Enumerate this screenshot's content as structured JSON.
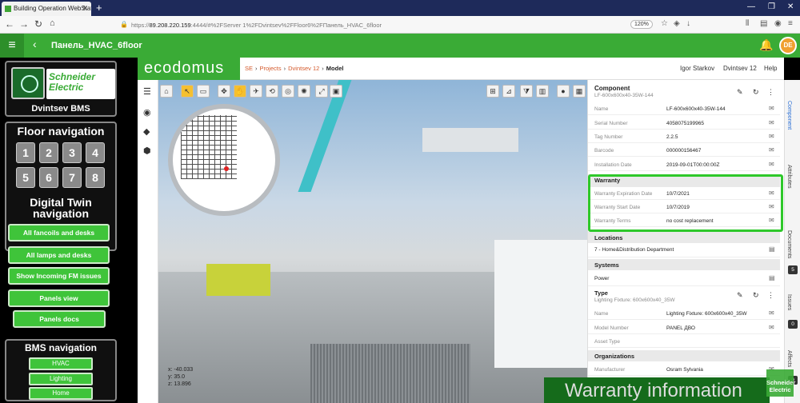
{
  "browser": {
    "tab_title": "Building Operation WebStation",
    "url_host": "89.208.220.159",
    "url_rest": ":4444/#%2FServer 1%2FDvintsev%2FFloor6%2FПанель_HVAC_6floor",
    "url_scheme": "https://",
    "zoom": "120%"
  },
  "app_header": {
    "title": "Панель_HVAC_6floor",
    "avatar": "DE"
  },
  "left_panel": {
    "brand": "Schneider Electric",
    "bms_title": "Dvintsev BMS",
    "floor_nav_title": "Floor navigation",
    "floors": [
      "1",
      "2",
      "3",
      "4",
      "5",
      "6",
      "7",
      "8"
    ],
    "digital_twin_title": "Digital Twin navigation",
    "digital_twin_buttons": [
      "All fancoils and desks",
      "All lamps and desks",
      "Show Incoming FM issues",
      "Panels view",
      "Panels docs"
    ],
    "bms_nav_title": "BMS navigation",
    "bms_buttons": [
      "HVAC",
      "Lighting",
      "Home"
    ]
  },
  "ecodomus": {
    "logo": "ecodomus",
    "breadcrumb": [
      "SE",
      "Projects",
      "Dvintsev 12",
      "Model"
    ],
    "user": "Igor Starkov",
    "project": "Dvintsev 12",
    "help": "Help"
  },
  "viewport": {
    "coords": [
      "x: -40.033",
      "y: 35.0",
      "z: 13.896"
    ]
  },
  "component": {
    "title": "Component",
    "subtitle": "LF-600x600x40-35W-144",
    "properties": [
      {
        "key": "Name",
        "value": "LF-600x600x40-35W-144"
      },
      {
        "key": "Serial Number",
        "value": "4058075199965"
      },
      {
        "key": "Tag Number",
        "value": "2.2.5"
      },
      {
        "key": "Barcode",
        "value": "000000156467"
      },
      {
        "key": "Installation Date",
        "value": "2019-09-01T00:00:00Z"
      }
    ],
    "warranty_title": "Warranty",
    "warranty": [
      {
        "key": "Warranty Expiration Date",
        "value": "10/7/2021"
      },
      {
        "key": "Warranty Start Date",
        "value": "10/7/2019"
      },
      {
        "key": "Warranty Terms",
        "value": "no cost replacement"
      }
    ],
    "locations_title": "Locations",
    "location": "7 - Home&Distribution Department",
    "systems_title": "Systems",
    "system": "Power",
    "type_title": "Type",
    "type_subtitle": "Lighting Fixture: 600x600x40_35W",
    "type_props": [
      {
        "key": "Name",
        "value": "Lighting Fixture: 600x600x40_35W"
      },
      {
        "key": "Model Number",
        "value": "PANEL ДВО"
      },
      {
        "key": "Asset Type",
        "value": ""
      }
    ],
    "organizations_title": "Organizations",
    "org_props": [
      {
        "key": "Manufacturer",
        "value": "Osram Sylvania"
      }
    ]
  },
  "right_tabs": [
    {
      "label": "Component",
      "badge": ""
    },
    {
      "label": "Attributes",
      "badge": ""
    },
    {
      "label": "Documents",
      "badge": "5"
    },
    {
      "label": "Issues",
      "badge": "0"
    },
    {
      "label": "Affects",
      "badge": "0"
    }
  ],
  "caption": "Warranty information",
  "watermark": "Schneider Electric"
}
